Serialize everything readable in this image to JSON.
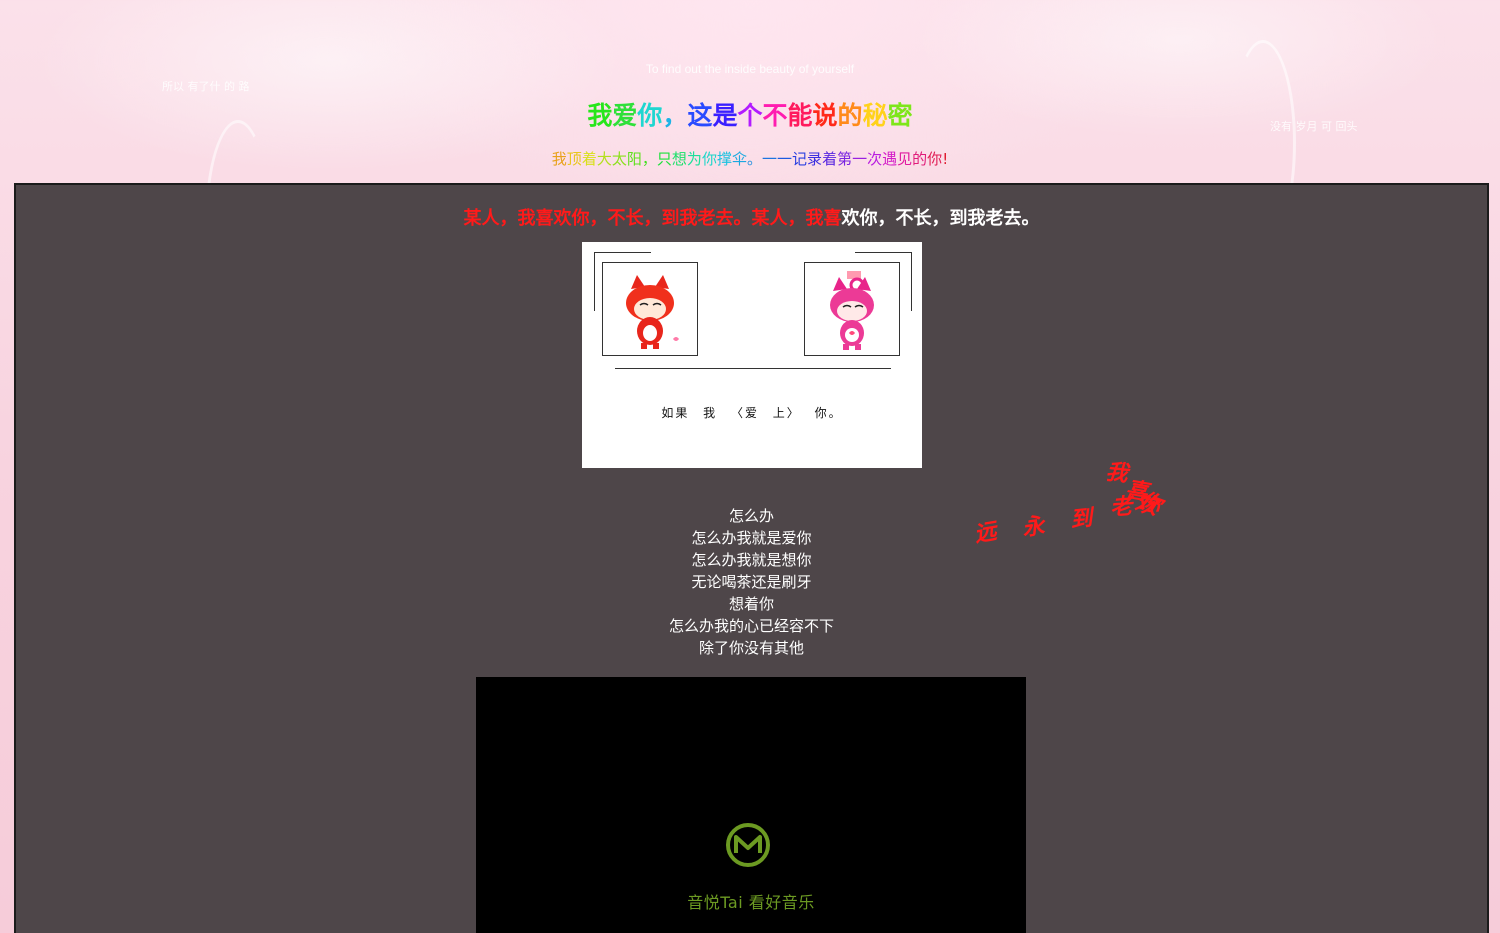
{
  "header": {
    "tagline_en": "To find out the inside beauty of yourself",
    "side_left": "所以 有了什 的 路",
    "side_right": "没有 岁月 可 回头"
  },
  "title": {
    "chars": [
      {
        "t": "我",
        "c": "#27e61b"
      },
      {
        "t": "爱",
        "c": "#2fe03a"
      },
      {
        "t": "你",
        "c": "#1fd6d0"
      },
      {
        "t": "，",
        "c": "#1fb3e6"
      },
      {
        "t": "这",
        "c": "#2a4bff"
      },
      {
        "t": "是",
        "c": "#3a1fff"
      },
      {
        "t": "个",
        "c": "#b21cff"
      },
      {
        "t": "不",
        "c": "#ff1cb0"
      },
      {
        "t": "能",
        "c": "#ff1a5e"
      },
      {
        "t": "说",
        "c": "#ff2a1a"
      },
      {
        "t": "的",
        "c": "#ff8a1a"
      },
      {
        "t": "秘",
        "c": "#ffd21a"
      },
      {
        "t": "密",
        "c": "#7ee61a"
      }
    ]
  },
  "subtitle": {
    "chars": [
      {
        "t": "我",
        "c": "#e8a21c"
      },
      {
        "t": "顶",
        "c": "#e8c71c"
      },
      {
        "t": "着",
        "c": "#d9e01c"
      },
      {
        "t": "大",
        "c": "#b3e01c"
      },
      {
        "t": "太",
        "c": "#8ce01c"
      },
      {
        "t": "阳",
        "c": "#5fe01c"
      },
      {
        "t": "，",
        "c": "#3ee01c"
      },
      {
        "t": "只",
        "c": "#1ce03a"
      },
      {
        "t": "想",
        "c": "#1ce06a"
      },
      {
        "t": "为",
        "c": "#1ce09a"
      },
      {
        "t": "你",
        "c": "#1cd6c8"
      },
      {
        "t": "撑",
        "c": "#1cc2e0"
      },
      {
        "t": "伞",
        "c": "#1ca8e0"
      },
      {
        "t": "。",
        "c": "#1c8ee0"
      },
      {
        "t": "一",
        "c": "#1c74e0"
      },
      {
        "t": "一",
        "c": "#1c5ae0"
      },
      {
        "t": "记",
        "c": "#2a40e0"
      },
      {
        "t": "录",
        "c": "#3c30e0"
      },
      {
        "t": "着",
        "c": "#5a28e0"
      },
      {
        "t": "第",
        "c": "#7a24e0"
      },
      {
        "t": "一",
        "c": "#9a20e0"
      },
      {
        "t": "次",
        "c": "#b81ce0"
      },
      {
        "t": "遇",
        "c": "#d41cc8"
      },
      {
        "t": "见",
        "c": "#e01ca0"
      },
      {
        "t": "的",
        "c": "#e01c7a"
      },
      {
        "t": "你",
        "c": "#e01c54"
      },
      {
        "t": "!",
        "c": "#e01c30"
      }
    ]
  },
  "marquee": {
    "red_text": "某人，我喜欢你，不长，到我老去。某人，我喜",
    "white_text": "欢你，不长，到我老去。"
  },
  "card": {
    "caption": "如果 我 〈爱 上〉 你。"
  },
  "lyrics": [
    "怎么办",
    "怎么办我就是爱你",
    "怎么办我就是想你",
    "无论喝茶还是刷牙",
    "想着你",
    "怎么办我的心已经容不下",
    "除了你没有其他"
  ],
  "floating_text": [
    "远",
    "永",
    "到",
    "老",
    "我",
    "喜",
    "欢",
    "你"
  ],
  "video": {
    "brand": "音悦Tai  看好音乐",
    "logo_letter": "M"
  },
  "colors": {
    "panel_bg": "#4e4649",
    "accent_red": "#ff1a1a",
    "video_green": "#6c9a22"
  }
}
